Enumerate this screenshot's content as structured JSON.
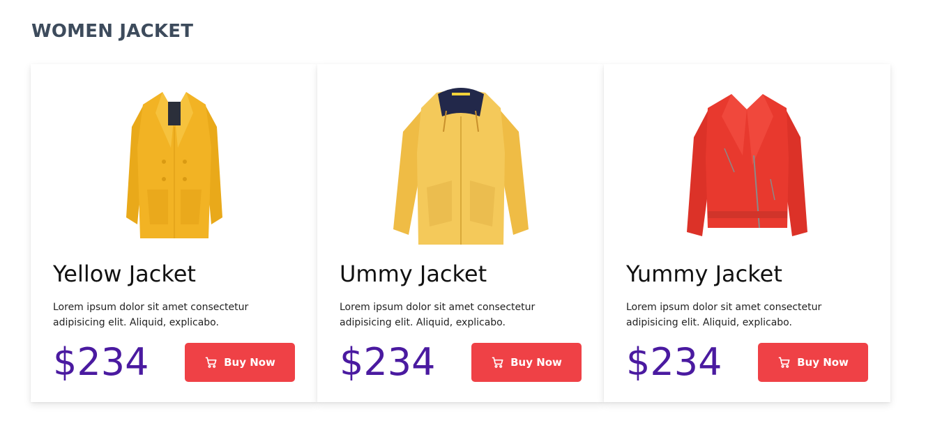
{
  "section": {
    "title": "WOMEN JACKET"
  },
  "products": [
    {
      "name": "Yellow Jacket",
      "description": "Lorem ipsum dolor sit amet consectetur adipisicing elit. Aliquid, explicabo.",
      "price": "$234",
      "button_label": "Buy Now",
      "image_color": "#f2b324",
      "image_icon": "yellow-peacoat-image"
    },
    {
      "name": "Ummy Jacket",
      "description": "Lorem ipsum dolor sit amet consectetur adipisicing elit. Aliquid, explicabo.",
      "price": "$234",
      "button_label": "Buy Now",
      "image_color": "#f4c95a",
      "image_icon": "yellow-raincoat-image"
    },
    {
      "name": "Yummy Jacket",
      "description": "Lorem ipsum dolor sit amet consectetur adipisicing elit. Aliquid, explicabo.",
      "price": "$234",
      "button_label": "Buy Now",
      "image_color": "#e8392e",
      "image_icon": "red-leather-jacket-image"
    }
  ],
  "colors": {
    "accent_button": "#ef4146",
    "price": "#4a1aa0",
    "title": "#3d4b5c"
  }
}
